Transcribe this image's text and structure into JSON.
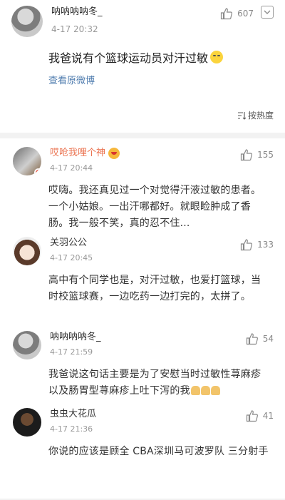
{
  "post": {
    "author": "呐呐呐呐冬_",
    "time": "4-17 20:32",
    "likes": "607",
    "text": "我爸说有个篮球运动员对汗过敏",
    "view_original": "查看原微博",
    "sort_label": "按热度"
  },
  "comments": [
    {
      "author": "哎呛我哩个神",
      "time": "4-17 20:44",
      "likes": "155",
      "text": "哎嗨。我还真见过一个对觉得汗液过敏的患者。一个小姑娘。一出汗哪都好。就眼睑肿成了香肠。我一般不笑，真的忍不住..."
    },
    {
      "author": "关羽公公",
      "time": "4-17 20:45",
      "likes": "133",
      "text": "高中有个同学也是，对汗过敏，也爱打篮球，当时校篮球赛，一边吃药一边打完的，太拼了。"
    },
    {
      "author": "呐呐呐呐冬_",
      "time": "4-17 21:59",
      "likes": "54",
      "text": "我爸说这句话主要是为了安慰当时过敏性荨麻疹以及肠胃型荨麻疹上吐下泻的我"
    },
    {
      "author": "虫虫大花瓜",
      "time": "4-17 21:36",
      "likes": "41",
      "text": "你说的应该是顾全  CBA深圳马可波罗队 三分射手"
    }
  ]
}
